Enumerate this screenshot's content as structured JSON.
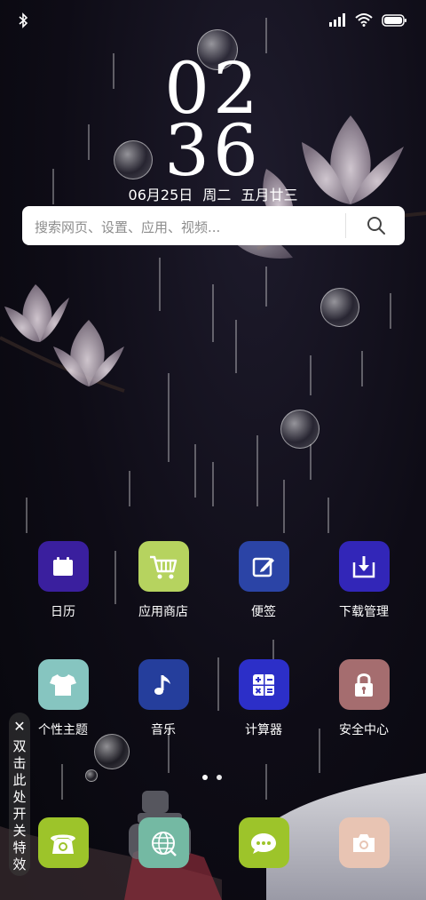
{
  "status_bar": {
    "left_icons": [
      "bluetooth-icon"
    ],
    "right_icons": [
      "cell-signal-icon",
      "wifi-icon",
      "battery-icon"
    ]
  },
  "clock": {
    "hour": "02",
    "minute": "36"
  },
  "date": {
    "text": "06月25日  周二  五月廿三"
  },
  "search": {
    "placeholder": "搜索网页、设置、应用、视频...",
    "icon": "search-icon"
  },
  "apps": [
    {
      "label": "日历",
      "icon": "calendar-icon",
      "color": "#3a1f9e"
    },
    {
      "label": "应用商店",
      "icon": "shopping-cart-icon",
      "color": "#b6d35f"
    },
    {
      "label": "便签",
      "icon": "edit-note-icon",
      "color": "#2b44a6"
    },
    {
      "label": "下载管理",
      "icon": "download-icon",
      "color": "#3226b8"
    },
    {
      "label": "个性主题",
      "icon": "tshirt-icon",
      "color": "#86c5c0"
    },
    {
      "label": "音乐",
      "icon": "music-note-icon",
      "color": "#253e9c"
    },
    {
      "label": "计算器",
      "icon": "calculator-icon",
      "color": "#2c2fc8"
    },
    {
      "label": "安全中心",
      "icon": "lock-icon",
      "color": "#a56d6f"
    }
  ],
  "page_indicator": {
    "pages": 2,
    "current": 1
  },
  "dock": [
    {
      "icon": "phone-icon",
      "color": "#9dc42a"
    },
    {
      "icon": "browser-globe-icon",
      "color": "#74b9a3"
    },
    {
      "icon": "message-icon",
      "color": "#9dc42a"
    },
    {
      "icon": "camera-icon",
      "color": "#e8c4b3"
    }
  ],
  "side_toggle": {
    "close": "✕",
    "text": "双击此处开关特效"
  }
}
